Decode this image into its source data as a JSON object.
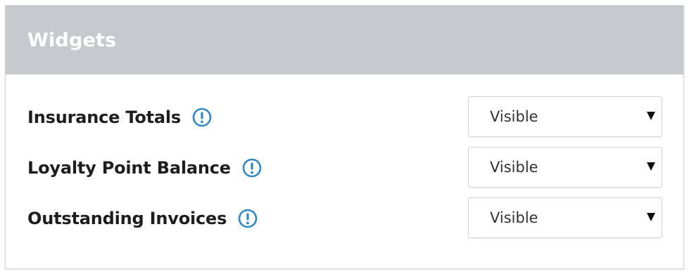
{
  "panel": {
    "title": "Widgets",
    "header_color": "#c6c9cd"
  },
  "rows": [
    {
      "label": "Insurance Totals",
      "icon": "info-icon",
      "select_value": "Visible"
    },
    {
      "label": "Loyalty Point Balance",
      "icon": "info-icon",
      "select_value": "Visible"
    },
    {
      "label": "Outstanding Invoices",
      "icon": "info-icon",
      "select_value": "Visible"
    }
  ],
  "colors": {
    "info_icon": "#2f86c4",
    "label_text": "#1e1e1e"
  }
}
